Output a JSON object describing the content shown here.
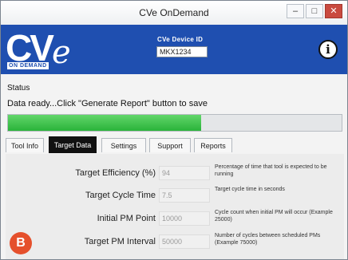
{
  "window": {
    "title": "CVe OnDemand",
    "controls": {
      "minimize": "–",
      "maximize": "□",
      "close": "✕"
    }
  },
  "header": {
    "logo_text": "CV",
    "logo_mark": "e",
    "logo_tagline": "ON DEMAND",
    "device_id_label": "CVe Device ID",
    "device_id_value": "MKX1234",
    "info_glyph": "i",
    "brand_color": "#1f4fb0"
  },
  "status": {
    "label": "Status",
    "message": "Data ready...Click \"Generate Report\" button to save",
    "progress_fraction": 0.58,
    "progress_color": "#2ab33a"
  },
  "tabs": [
    {
      "label": "Tool Info",
      "active": false
    },
    {
      "label": "Target Data",
      "active": true
    },
    {
      "label": "Settings",
      "active": false
    },
    {
      "label": "Support",
      "active": false
    },
    {
      "label": "Reports",
      "active": false
    }
  ],
  "fields": [
    {
      "label": "Target Efficiency (%)",
      "value": "94",
      "hint": "Percentage of time that tool is expected to be running"
    },
    {
      "label": "Target Cycle Time",
      "value": "7.5",
      "hint": "Target cycle time in seconds"
    },
    {
      "label": "Initial PM Point",
      "value": "10000",
      "hint": "Cycle count when initial PM will occur (Example 25000)"
    },
    {
      "label": "Target PM Interval",
      "value": "50000",
      "hint": "Number of cycles between scheduled PMs (Example 75000)"
    }
  ],
  "badge": {
    "letter": "B",
    "color": "#e5502c"
  }
}
